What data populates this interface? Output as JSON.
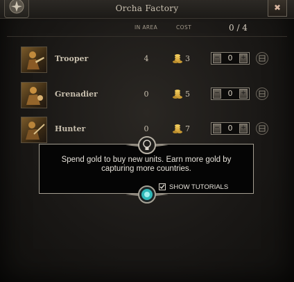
{
  "window": {
    "title": "Orcha Factory",
    "close_label": "✖"
  },
  "headers": {
    "in_area": "IN AREA",
    "cost": "COST",
    "count": "0 / 4"
  },
  "units": [
    {
      "name": "Trooper",
      "in_area": "4",
      "cost": "3",
      "quantity": "0",
      "icon": "trooper-portrait"
    },
    {
      "name": "Grenadier",
      "in_area": "0",
      "cost": "5",
      "quantity": "0",
      "icon": "grenadier-portrait"
    },
    {
      "name": "Hunter",
      "in_area": "0",
      "cost": "7",
      "quantity": "0",
      "icon": "hunter-portrait"
    }
  ],
  "tutorial": {
    "text": "Spend gold to buy new units. Earn more gold by capturing more countries.",
    "checkbox_label": "SHOW TUTORIALS",
    "checked": true
  },
  "colors": {
    "gold": "#c8a046",
    "tutorial_accent": "#3cc9c9",
    "text": "#c8bfae"
  }
}
